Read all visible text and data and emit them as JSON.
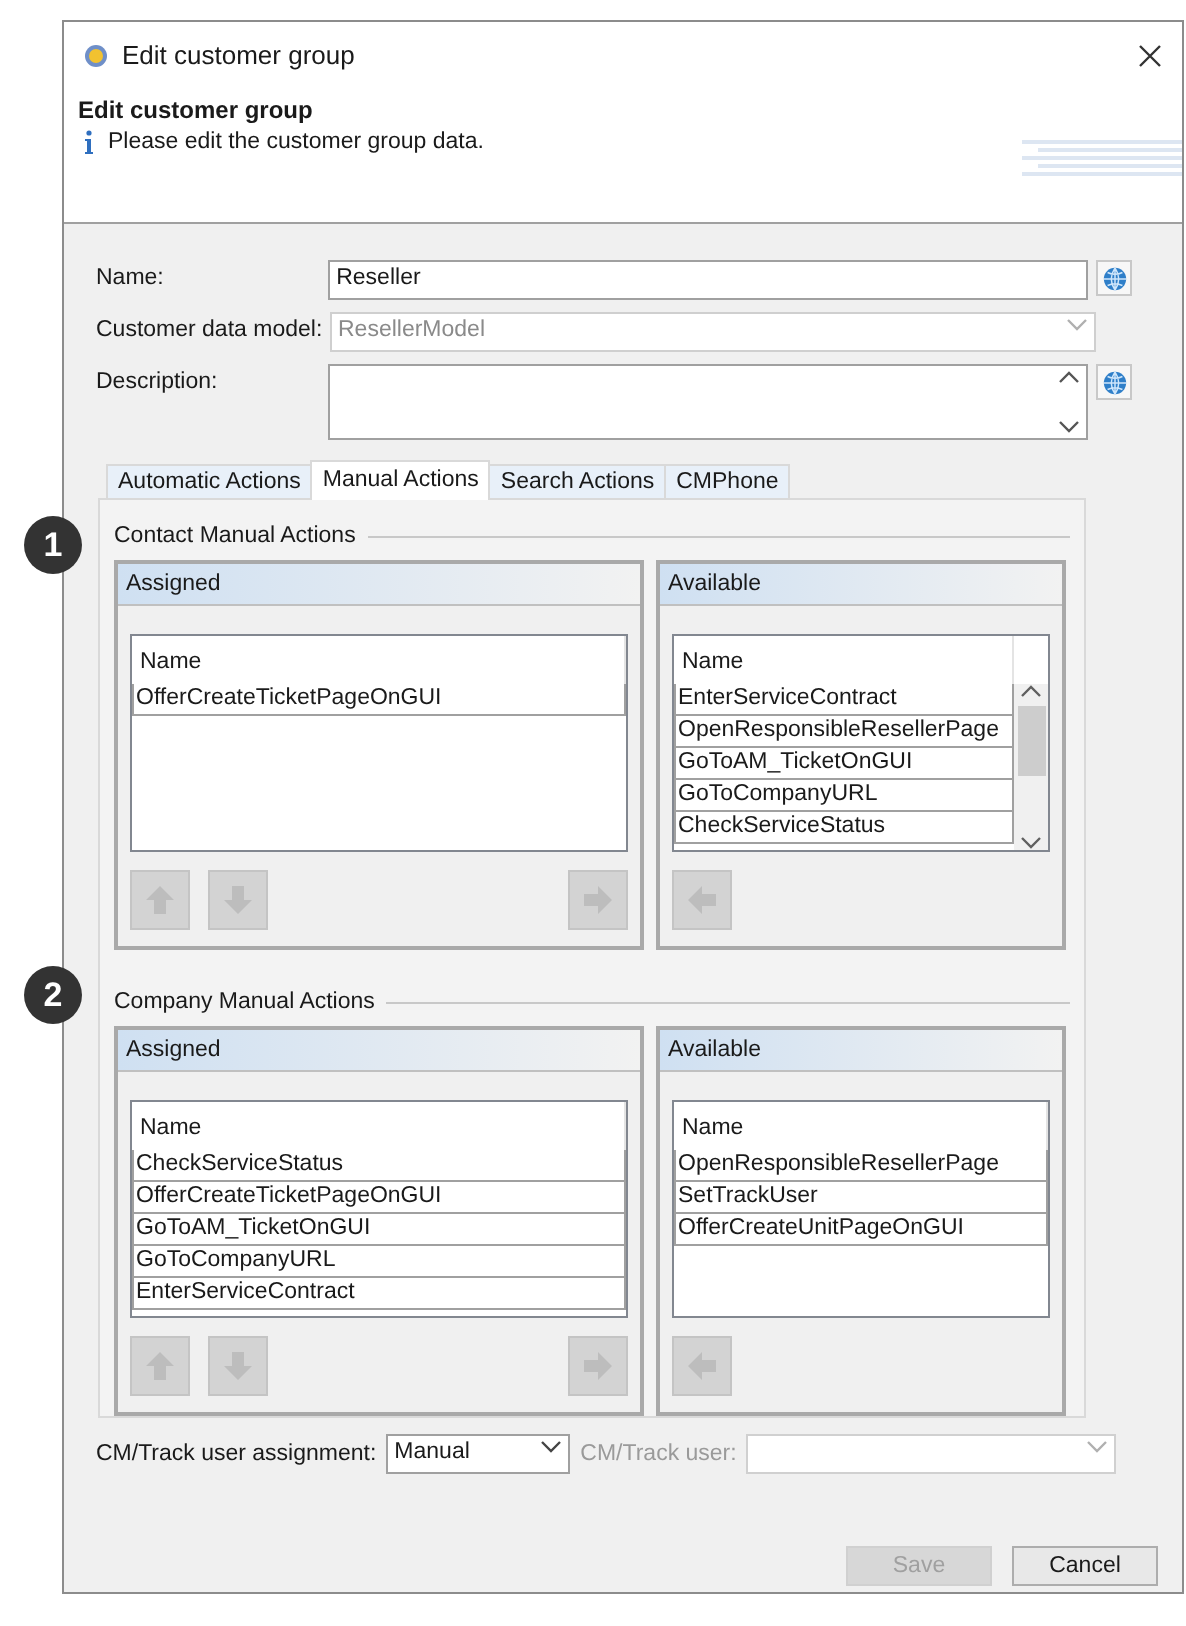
{
  "window": {
    "title": "Edit customer group"
  },
  "header": {
    "title": "Edit customer group",
    "message": "Please edit the customer group data."
  },
  "form": {
    "name": {
      "label": "Name:",
      "value": "Reseller"
    },
    "data_model": {
      "label": "Customer data model:",
      "value": "ResellerModel",
      "disabled": true
    },
    "description": {
      "label": "Description:"
    }
  },
  "tabs": [
    {
      "label": "Automatic Actions",
      "selected": false
    },
    {
      "label": "Manual Actions",
      "selected": true
    },
    {
      "label": "Search Actions",
      "selected": false
    },
    {
      "label": "CMPhone",
      "selected": false
    }
  ],
  "sections": [
    {
      "badge": "1",
      "title": "Contact Manual Actions",
      "assigned": {
        "title": "Assigned",
        "column": "Name",
        "scrollable": false,
        "rows": [
          "OfferCreateTicketPageOnGUI"
        ]
      },
      "available": {
        "title": "Available",
        "column": "Name",
        "scrollable": true,
        "rows": [
          "EnterServiceContract",
          "OpenResponsibleResellerPage",
          "GoToAM_TicketOnGUI",
          "GoToCompanyURL",
          "CheckServiceStatus"
        ]
      }
    },
    {
      "badge": "2",
      "title": "Company Manual Actions",
      "assigned": {
        "title": "Assigned",
        "column": "Name",
        "scrollable": false,
        "rows": [
          "CheckServiceStatus",
          "OfferCreateTicketPageOnGUI",
          "GoToAM_TicketOnGUI",
          "GoToCompanyURL",
          "EnterServiceContract"
        ]
      },
      "available": {
        "title": "Available",
        "column": "Name",
        "scrollable": false,
        "rows": [
          "OpenResponsibleResellerPage",
          "SetTrackUser",
          "OfferCreateUnitPageOnGUI"
        ]
      }
    }
  ],
  "assignment": {
    "label": "CM/Track user assignment:",
    "value": "Manual"
  },
  "track_user": {
    "label": "CM/Track user:",
    "disabled": true
  },
  "buttons": [
    {
      "label": "Save",
      "disabled": true
    },
    {
      "label": "Cancel",
      "disabled": false
    }
  ]
}
